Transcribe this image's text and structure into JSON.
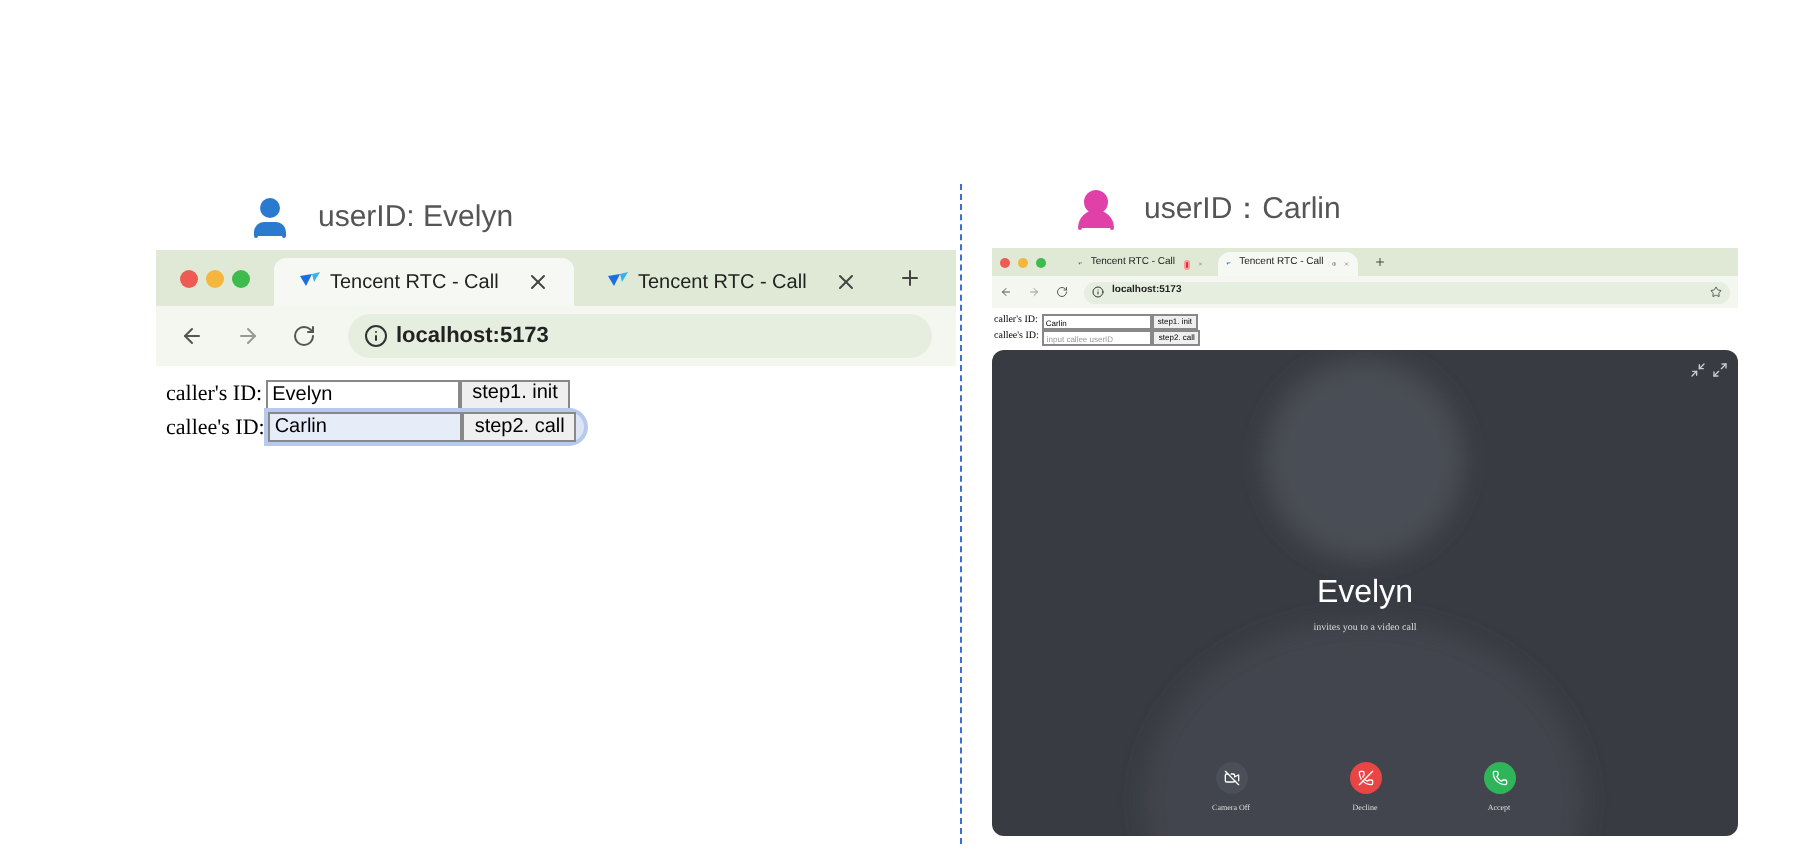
{
  "panels": [
    {
      "user": {
        "label": "userID: Evelyn",
        "kind": "man"
      },
      "browser": {
        "tabs": [
          {
            "title": "Tencent RTC - Call",
            "selected": true,
            "recording": false,
            "audio": false
          },
          {
            "title": "Tencent RTC - Call",
            "selected": false,
            "recording": false,
            "audio": false
          }
        ],
        "url": "localhost:5173"
      },
      "form": [
        {
          "label": "caller's ID:",
          "value": "Evelyn",
          "button": "step1. init",
          "focused": false
        },
        {
          "label": "callee's ID:",
          "value": "Carlin",
          "button": "step2. call",
          "focused": true
        }
      ]
    },
    {
      "user": {
        "label": "userID：Carlin",
        "kind": "woman"
      },
      "browser": {
        "tabs": [
          {
            "title": "Tencent RTC - Call",
            "selected": false,
            "recording": true,
            "audio": false
          },
          {
            "title": "Tencent RTC - Call",
            "selected": true,
            "recording": false,
            "audio": true
          }
        ],
        "url": "localhost:5173",
        "bookmark": true
      },
      "form": [
        {
          "label": "caller's ID:",
          "value": "Carlin",
          "button": "step1. init",
          "focused": false
        },
        {
          "label": "callee's ID:",
          "placeholder": "input callee userID",
          "button": "step2. call",
          "focused": false
        }
      ],
      "call": {
        "caller": "Evelyn",
        "message": "invites you to a video call",
        "actions": [
          {
            "label": "Camera Off",
            "kind": "camera"
          },
          {
            "label": "Decline",
            "kind": "decline"
          },
          {
            "label": "Accept",
            "kind": "accept"
          }
        ]
      }
    }
  ]
}
